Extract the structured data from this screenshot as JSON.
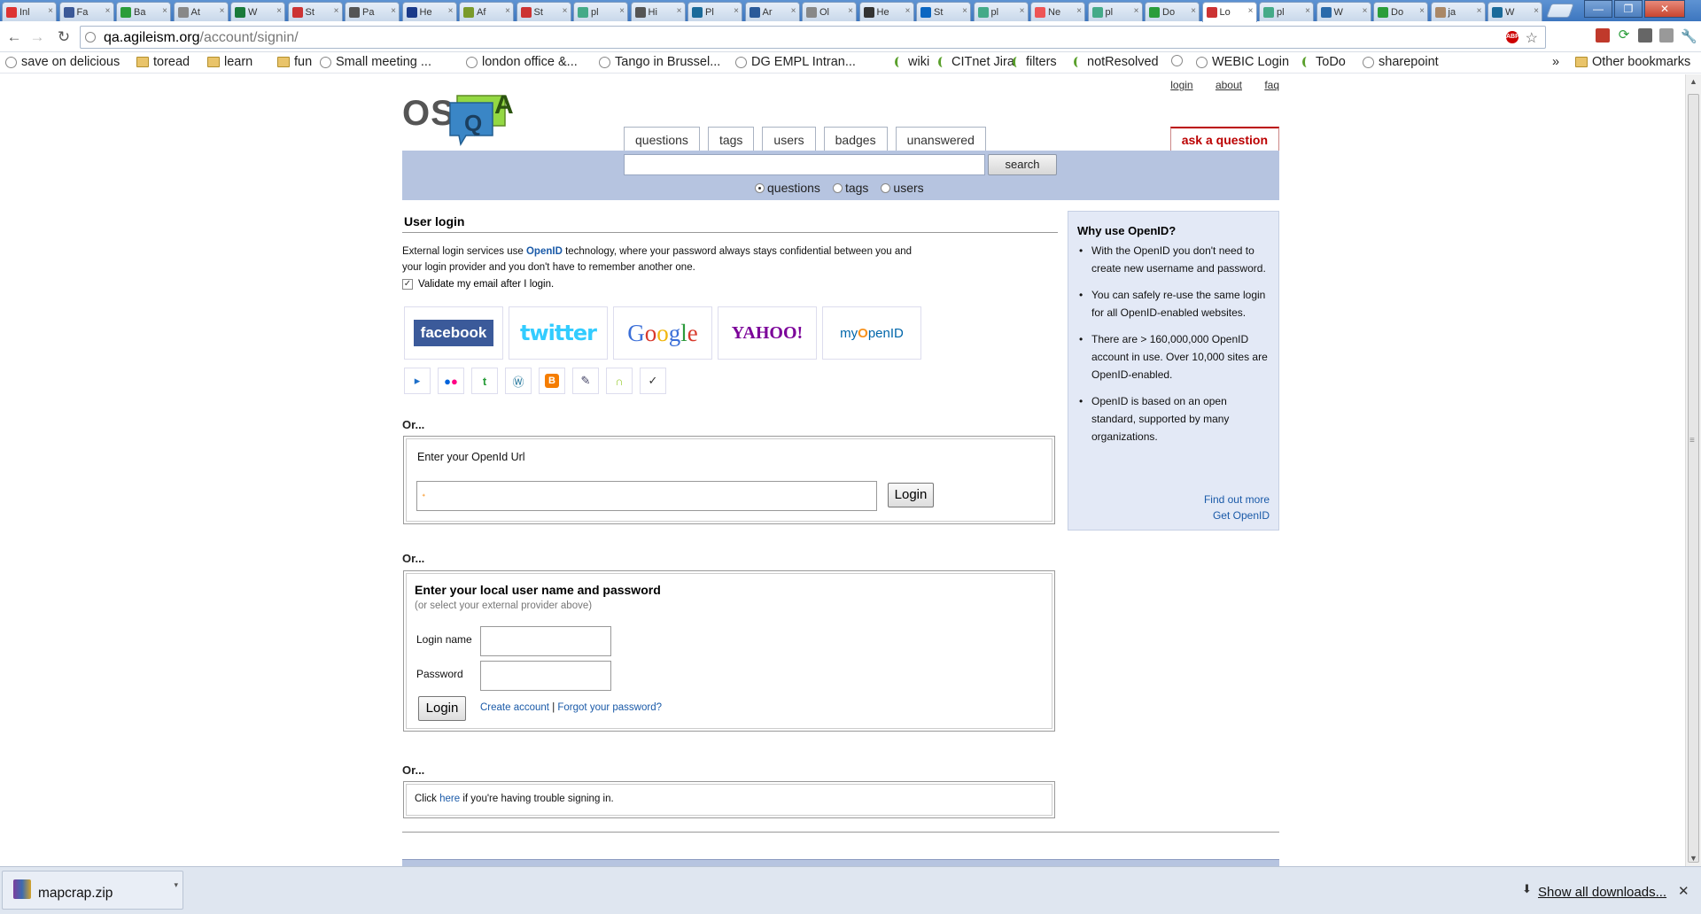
{
  "browser": {
    "tabs": [
      {
        "label": "Inl",
        "color": "#d33"
      },
      {
        "label": "Fa",
        "color": "#3b5998"
      },
      {
        "label": "Ba",
        "color": "#2a9d3a"
      },
      {
        "label": "At",
        "color": "#888"
      },
      {
        "label": "W",
        "color": "#1a7a3a"
      },
      {
        "label": "St",
        "color": "#c33"
      },
      {
        "label": "Pa",
        "color": "#555"
      },
      {
        "label": "He",
        "color": "#1a3a8a"
      },
      {
        "label": "Af",
        "color": "#7a9a2a"
      },
      {
        "label": "St",
        "color": "#c33"
      },
      {
        "label": "pl",
        "color": "#4a8"
      },
      {
        "label": "Hi",
        "color": "#555"
      },
      {
        "label": "Pl",
        "color": "#1a6a9a"
      },
      {
        "label": "Ar",
        "color": "#2a5a9a"
      },
      {
        "label": "Ol",
        "color": "#888"
      },
      {
        "label": "He",
        "color": "#333"
      },
      {
        "label": "St",
        "color": "#0a66c2"
      },
      {
        "label": "pl",
        "color": "#4a8"
      },
      {
        "label": "Ne",
        "color": "#e55"
      },
      {
        "label": "pl",
        "color": "#4a8"
      },
      {
        "label": "Do",
        "color": "#2a9d3a"
      },
      {
        "label": "Lo",
        "color": "#c33",
        "active": true
      },
      {
        "label": "pl",
        "color": "#4a8"
      },
      {
        "label": "W",
        "color": "#2a6aaa"
      },
      {
        "label": "Do",
        "color": "#2a9d3a"
      },
      {
        "label": "ja",
        "color": "#a86"
      },
      {
        "label": "W",
        "color": "#1a6a9a"
      }
    ],
    "url_host": "qa.agileism.org",
    "url_path": "/account/signin/",
    "back_icon": "back-arrow-icon",
    "forward_icon": "forward-arrow-icon",
    "reload_icon": "reload-icon",
    "bookmarks": [
      {
        "label": "save on delicious",
        "icon": "globe"
      },
      {
        "label": "toread",
        "icon": "folder"
      },
      {
        "label": "learn",
        "icon": "folder"
      },
      {
        "label": "fun",
        "icon": "folder"
      },
      {
        "label": "Small meeting ...",
        "icon": "globe"
      },
      {
        "label": "london office &...",
        "icon": "globe"
      },
      {
        "label": "Tango in Brussel...",
        "icon": "globe"
      },
      {
        "label": "DG EMPL Intran...",
        "icon": "globe"
      },
      {
        "label": "wiki",
        "icon": "c"
      },
      {
        "label": "CITnet Jira",
        "icon": "c"
      },
      {
        "label": "filters",
        "icon": "c"
      },
      {
        "label": "notResolved",
        "icon": "c"
      },
      {
        "label": "",
        "icon": "globe"
      },
      {
        "label": "WEBIC Login",
        "icon": "globe"
      },
      {
        "label": "ToDo",
        "icon": "c"
      },
      {
        "label": "sharepoint",
        "icon": "globe"
      }
    ],
    "bookmarks_overflow": "»",
    "other_bookmarks": "Other bookmarks",
    "win_min": "—",
    "win_max": "❐",
    "win_close": "✕"
  },
  "site": {
    "logo_os": "OS",
    "logo_q": "Q",
    "logo_a": "A",
    "top_links": {
      "login": "login",
      "about": "about",
      "faq": "faq"
    },
    "nav_tabs": [
      "questions",
      "tags",
      "users",
      "badges",
      "unanswered"
    ],
    "ask_button": "ask a question",
    "search": {
      "value": "",
      "button": "search",
      "scopes": [
        {
          "label": "questions",
          "checked": true
        },
        {
          "label": "tags",
          "checked": false
        },
        {
          "label": "users",
          "checked": false
        }
      ]
    }
  },
  "login": {
    "title": "User login",
    "intro_before": "External login services use ",
    "intro_link": "OpenID",
    "intro_after": " technology, where your password always stays confidential between you and your login provider and you don't have to remember another one.",
    "validate_label": "Validate my email after I login.",
    "validate_checked": true,
    "providers": {
      "facebook": "facebook",
      "twitter": "twitter",
      "google": "Google",
      "yahoo": "YAHOO!",
      "myopenid_pre": "my",
      "myopenid_post": "penID"
    },
    "small_providers": [
      "aol-icon",
      "flickr-icon",
      "technorati-icon",
      "wordpress-icon",
      "blogger-icon",
      "livejournal-icon",
      "claimid-icon",
      "vidoop-icon"
    ],
    "or1": "Or...",
    "openid_label": "Enter your OpenId Url",
    "openid_value": "",
    "openid_login": "Login",
    "or2": "Or...",
    "local_title": "Enter your local user name and password",
    "local_sub": "(or select your external provider above)",
    "login_name_label": "Login name",
    "password_label": "Password",
    "local_login": "Login",
    "create_account": "Create account",
    "separator": " | ",
    "forgot_password": "Forgot your password?",
    "or3": "Or...",
    "trouble_before": "Click ",
    "trouble_link": "here",
    "trouble_after": " if you're having trouble signing in."
  },
  "sidebar": {
    "title": "Why use OpenID?",
    "points": [
      "With the OpenID you don't need to create new username and password.",
      "You can safely re-use the same login for all OpenID-enabled websites.",
      "There are > 160,000,000 OpenID account in use. Over 10,000 sites are OpenID-enabled.",
      "OpenID is based on an open standard, supported by many organizations."
    ],
    "find_out_more": "Find out more",
    "get_openid": "Get OpenID"
  },
  "downloads": {
    "file": "mapcrap.zip",
    "show_all": "Show all downloads...",
    "close": "✕"
  }
}
